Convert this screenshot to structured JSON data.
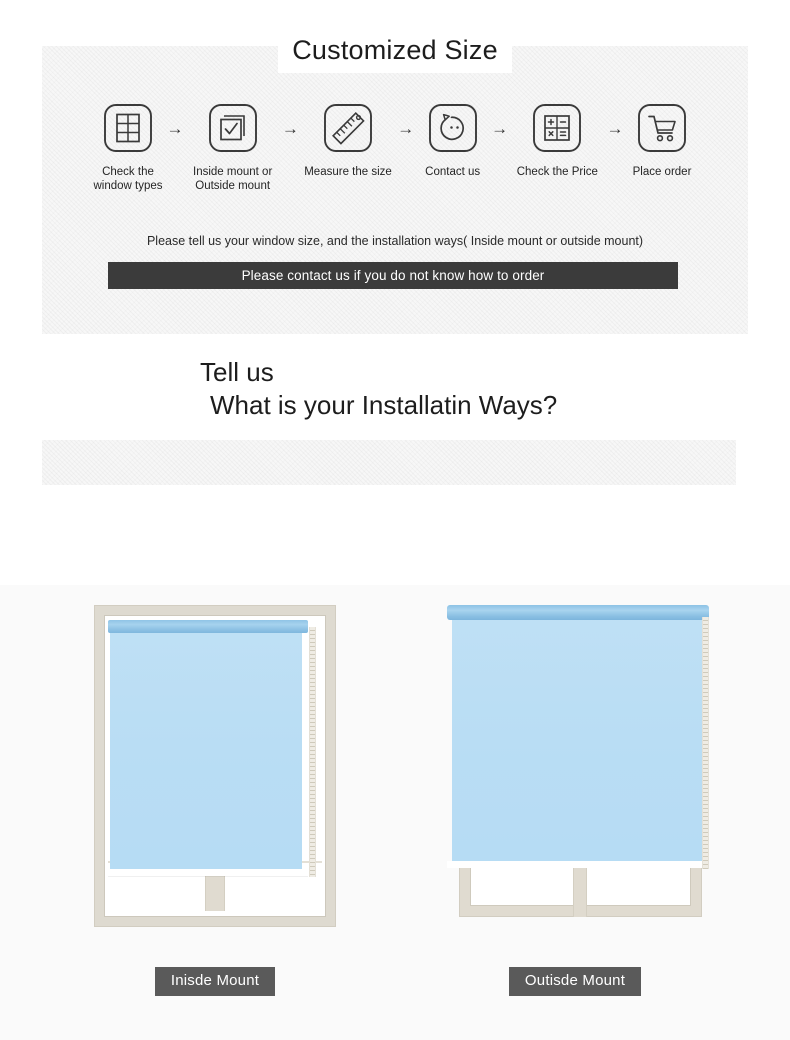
{
  "hero": {
    "title": "Customized Size",
    "steps": [
      {
        "icon": "window-grid-icon",
        "label_lines": [
          "Check the",
          "window types"
        ],
        "wide": false
      },
      {
        "icon": "checkbox-layers-icon",
        "label_lines": [
          "Inside mount or",
          "Outside mount"
        ],
        "wide": true
      },
      {
        "icon": "ruler-icon",
        "label_lines": [
          "Measure the size"
        ],
        "wide": true
      },
      {
        "icon": "contact-face-icon",
        "label_lines": [
          "Contact us"
        ],
        "wide": false
      },
      {
        "icon": "calculator-icon",
        "label_lines": [
          "Check the Price"
        ],
        "wide": true
      },
      {
        "icon": "shopping-cart-icon",
        "label_lines": [
          "Place order"
        ],
        "wide": false
      }
    ],
    "arrow": "→",
    "note": "Please tell us your window size, and the installation ways( Inside mount or outside mount)",
    "cta": "Please contact us if you do not know how to order"
  },
  "mid": {
    "line1": "Tell us",
    "line2": "What is your Installatin Ways?"
  },
  "showcase": {
    "inside": {
      "caption": "Inisde Mount"
    },
    "outside": {
      "caption": "Outisde Mount"
    }
  },
  "colors": {
    "panel_bg": "#f7f7f7",
    "dark_bar": "#3b3b3b",
    "caption_bg": "#5a5a5a",
    "shade_blue": "#b9ddf4",
    "headrail_blue": "#8cc2e5",
    "frame_beige": "#e0dbd0",
    "section_bg": "#fafafa",
    "text": "#1d1d1d"
  }
}
